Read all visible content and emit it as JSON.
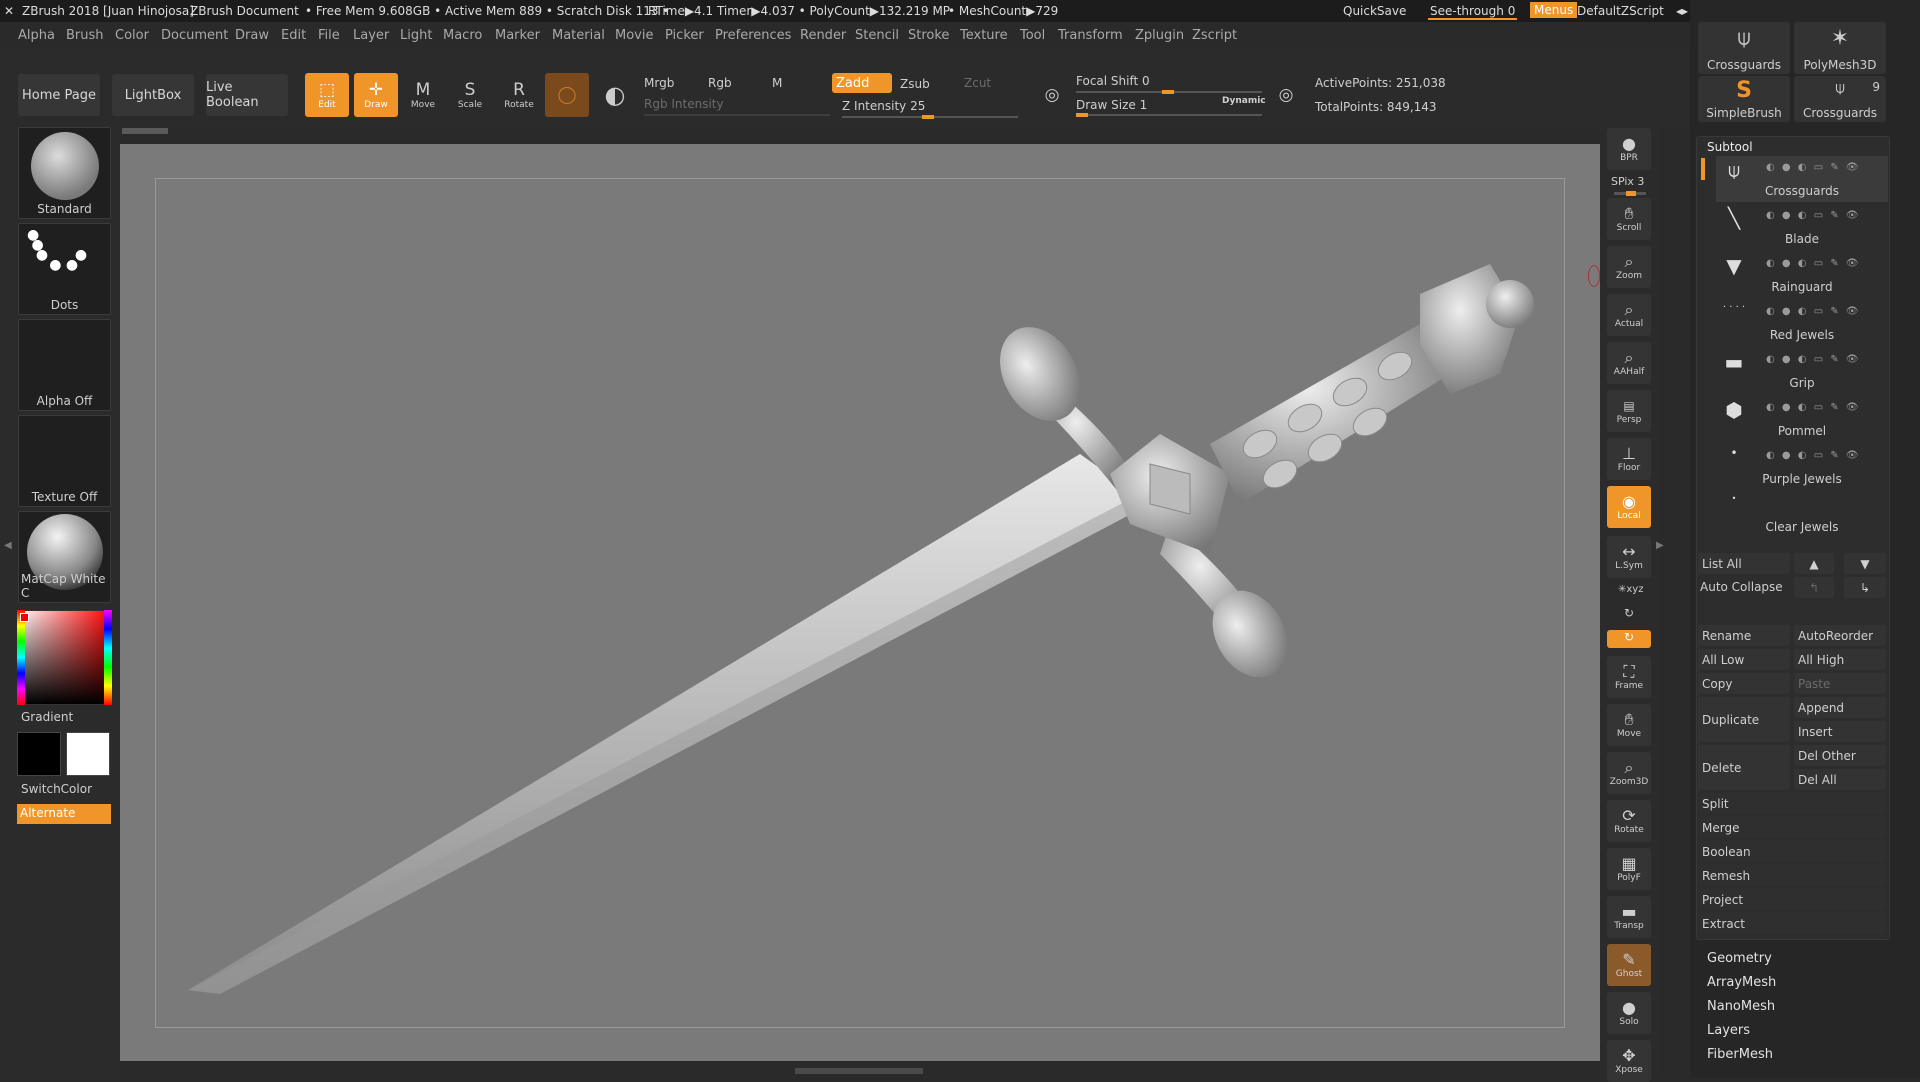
{
  "titlebar": {
    "app": "ZBrush 2018 [Juan Hinojosa]",
    "document": "ZBrush Document",
    "stats": "• Free Mem 9.608GB • Active Mem 889 • Scratch Disk 113 •",
    "timers": "RTime▶4.1 Timer▶4.037 • PolyCount▶132.219 MP",
    "meshcount": "• MeshCount▶729",
    "quicksave": "QuickSave",
    "seethrough": "See-through",
    "seethrough_value": "0",
    "menus": "Menus",
    "zscript": "DefaultZScript"
  },
  "menubar": [
    "Alpha",
    "Brush",
    "Color",
    "Document",
    "Draw",
    "Edit",
    "File",
    "Layer",
    "Light",
    "Macro",
    "Marker",
    "Material",
    "Movie",
    "Picker",
    "Preferences",
    "Render",
    "Stencil",
    "Stroke",
    "Texture",
    "Tool",
    "Transform",
    "Zplugin",
    "Zscript"
  ],
  "toolbar": {
    "home": "Home Page",
    "lightbox": "LightBox",
    "liveboolean": "Live Boolean",
    "edit": "Edit",
    "draw": "Draw",
    "move": "Move",
    "scale": "Scale",
    "rotate": "Rotate",
    "mrgb": "Mrgb",
    "rgb": "Rgb",
    "m": "M",
    "rgb_intensity": "Rgb Intensity",
    "zadd": "Zadd",
    "zsub": "Zsub",
    "zcut": "Zcut",
    "z_intensity": "Z Intensity 25",
    "focal_shift": "Focal Shift 0",
    "draw_size": "Draw Size 1",
    "dynamic": "Dynamic",
    "active_points": "ActivePoints: 251,038",
    "total_points": "TotalPoints: 849,143"
  },
  "leftshelf": {
    "brush": "Standard",
    "stroke": "Dots",
    "alpha": "Alpha Off",
    "texture": "Texture Off",
    "material": "MatCap White C",
    "gradient": "Gradient",
    "switchcolor": "SwitchColor",
    "alternate": "Alternate"
  },
  "rightshelf": [
    {
      "name": "bpr",
      "label": "BPR"
    },
    {
      "name": "spix",
      "label": "SPix 3"
    },
    {
      "name": "scroll",
      "label": "Scroll"
    },
    {
      "name": "zoom",
      "label": "Zoom"
    },
    {
      "name": "actual",
      "label": "Actual"
    },
    {
      "name": "aahalf",
      "label": "AAHalf"
    },
    {
      "name": "persp",
      "label": "Persp"
    },
    {
      "name": "floor",
      "label": "Floor"
    },
    {
      "name": "local",
      "label": "Local"
    },
    {
      "name": "lsym",
      "label": "L.Sym"
    },
    {
      "name": "frame",
      "label": "Frame"
    },
    {
      "name": "move",
      "label": "Move"
    },
    {
      "name": "zoom3d",
      "label": "Zoom3D"
    },
    {
      "name": "rotate",
      "label": "Rotate"
    },
    {
      "name": "polyf",
      "label": "PolyF"
    },
    {
      "name": "transp",
      "label": "Transp"
    },
    {
      "name": "ghost",
      "label": "Ghost"
    },
    {
      "name": "solo",
      "label": "Solo"
    },
    {
      "name": "xpose",
      "label": "Xpose"
    }
  ],
  "tray": {
    "tools": [
      {
        "label": "Crossguards"
      },
      {
        "label": "PolyMesh3D"
      },
      {
        "label": "SimpleBrush"
      },
      {
        "label": "Crossguards",
        "count": "9"
      }
    ],
    "subtool_title": "Subtool",
    "subtools": [
      "Crossguards",
      "Blade",
      "Rainguard",
      "Red Jewels",
      "Grip",
      "Pommel",
      "Purple Jewels",
      "Clear Jewels"
    ],
    "list_all": "List All",
    "auto_collapse": "Auto Collapse",
    "buttons": {
      "rename": "Rename",
      "autoreorder": "AutoReorder",
      "alllow": "All Low",
      "allhigh": "All High",
      "copy": "Copy",
      "paste": "Paste",
      "duplicate": "Duplicate",
      "append": "Append",
      "insert": "Insert",
      "delete": "Delete",
      "delother": "Del Other",
      "delall": "Del All",
      "split": "Split",
      "merge": "Merge",
      "boolean": "Boolean",
      "remesh": "Remesh",
      "project": "Project",
      "extract": "Extract"
    },
    "menus": [
      "Geometry",
      "ArrayMesh",
      "NanoMesh",
      "Layers",
      "FiberMesh"
    ]
  },
  "colors": {
    "accent": "#f0952a",
    "bg": "#2a2a2a",
    "viewport": "#7a7a7a"
  }
}
